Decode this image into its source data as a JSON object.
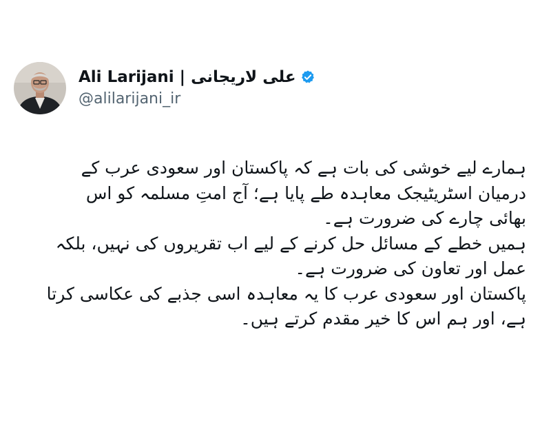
{
  "author": {
    "display_name": "Ali Larijani | علی لاریجانی",
    "handle": "@alilarijani_ir",
    "verified_badge": "verified-badge-icon",
    "verified_color": "#1d9bf0"
  },
  "tweet": {
    "lines": [
      "ہمارے لیے خوشی کی بات ہے کہ پاکستان اور سعودی عرب کے",
      "درمیان اسٹریٹیجک معاہدہ طے پایا ہے؛ آج امتِ مسلمہ کو اس",
      "بھائی چارے کی ضرورت ہے۔",
      "ہمیں خطے کے مسائل حل کرنے کے لیے اب تقریروں کی نہیں، بلکہ",
      "عمل اور تعاون کی ضرورت ہے۔",
      "پاکستان اور سعودی عرب کا یہ معاہدہ اسی جذبے کی عکاسی کرتا",
      "ہے، اور ہم اس کا خیر مقدم کرتے ہیں۔"
    ]
  }
}
